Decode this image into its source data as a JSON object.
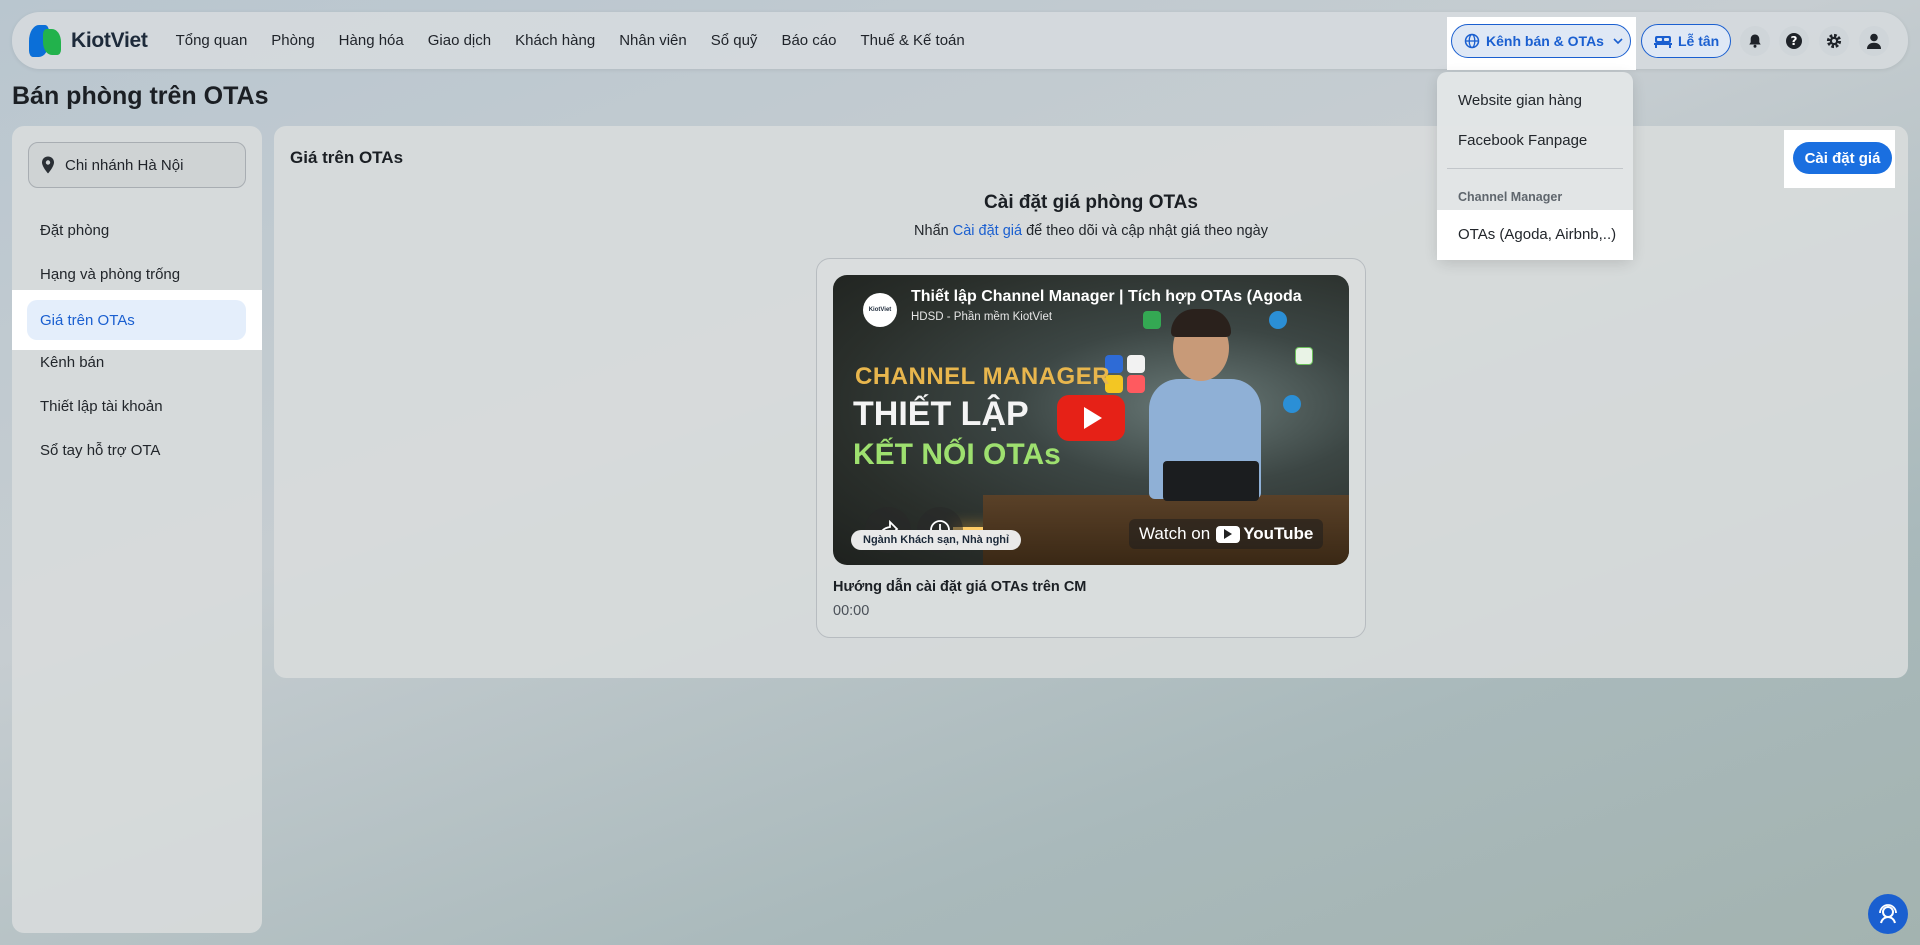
{
  "app": {
    "name": "KiotViet"
  },
  "nav": [
    "Tổng quan",
    "Phòng",
    "Hàng hóa",
    "Giao dịch",
    "Khách hàng",
    "Nhân viên",
    "Sổ quỹ",
    "Báo cáo",
    "Thuế & Kế toán"
  ],
  "header": {
    "channel_button": "Kênh bán & OTAs",
    "reception_button": "Lễ tân",
    "icons": [
      "bell-icon",
      "help-icon",
      "gear-icon",
      "user-icon"
    ]
  },
  "dropdown": {
    "items": [
      "Website gian hàng",
      "Facebook Fanpage"
    ],
    "section_header": "Channel Manager",
    "section_items": [
      "OTAs (Agoda, Airbnb,..)"
    ]
  },
  "page": {
    "title": "Bán phòng trên OTAs"
  },
  "sidebar": {
    "branch": "Chi nhánh Hà Nội",
    "items": [
      "Đặt phòng",
      "Hạng và phòng trống",
      "Giá trên OTAs",
      "Kênh bán",
      "Thiết lập tài khoản",
      "Sổ tay hỗ trợ OTA"
    ],
    "active_index": 2
  },
  "main": {
    "title": "Giá trên OTAs",
    "set_price_button": "Cài đặt giá",
    "center_title": "Cài đặt giá phòng OTAs",
    "subtitle_prefix": "Nhấn",
    "subtitle_link": "Cài đặt giá",
    "subtitle_suffix": "để theo dõi và cập nhật giá theo ngày",
    "video": {
      "title": "Thiết lập Channel Manager | Tích hợp OTAs (Agoda",
      "channel": "HDSD - Phần mềm KiotViet",
      "channel_avatar": "KiotViet",
      "overlay_line1": "CHANNEL MANAGER",
      "overlay_line2": "THIẾT LẬP",
      "overlay_line3": "KẾT NỐI OTAs",
      "tag": "Ngành Khách sạn, Nhà nghỉ",
      "watch_on": "Watch on",
      "youtube": "YouTube",
      "caption": "Hướng dẫn cài đặt giá OTAs trên CM",
      "duration": "00:00"
    }
  },
  "colors": {
    "accent": "#1a6fe0",
    "brand_blue": "#0b6fd8",
    "brand_green": "#22b24c",
    "youtube_red": "#e62117"
  }
}
